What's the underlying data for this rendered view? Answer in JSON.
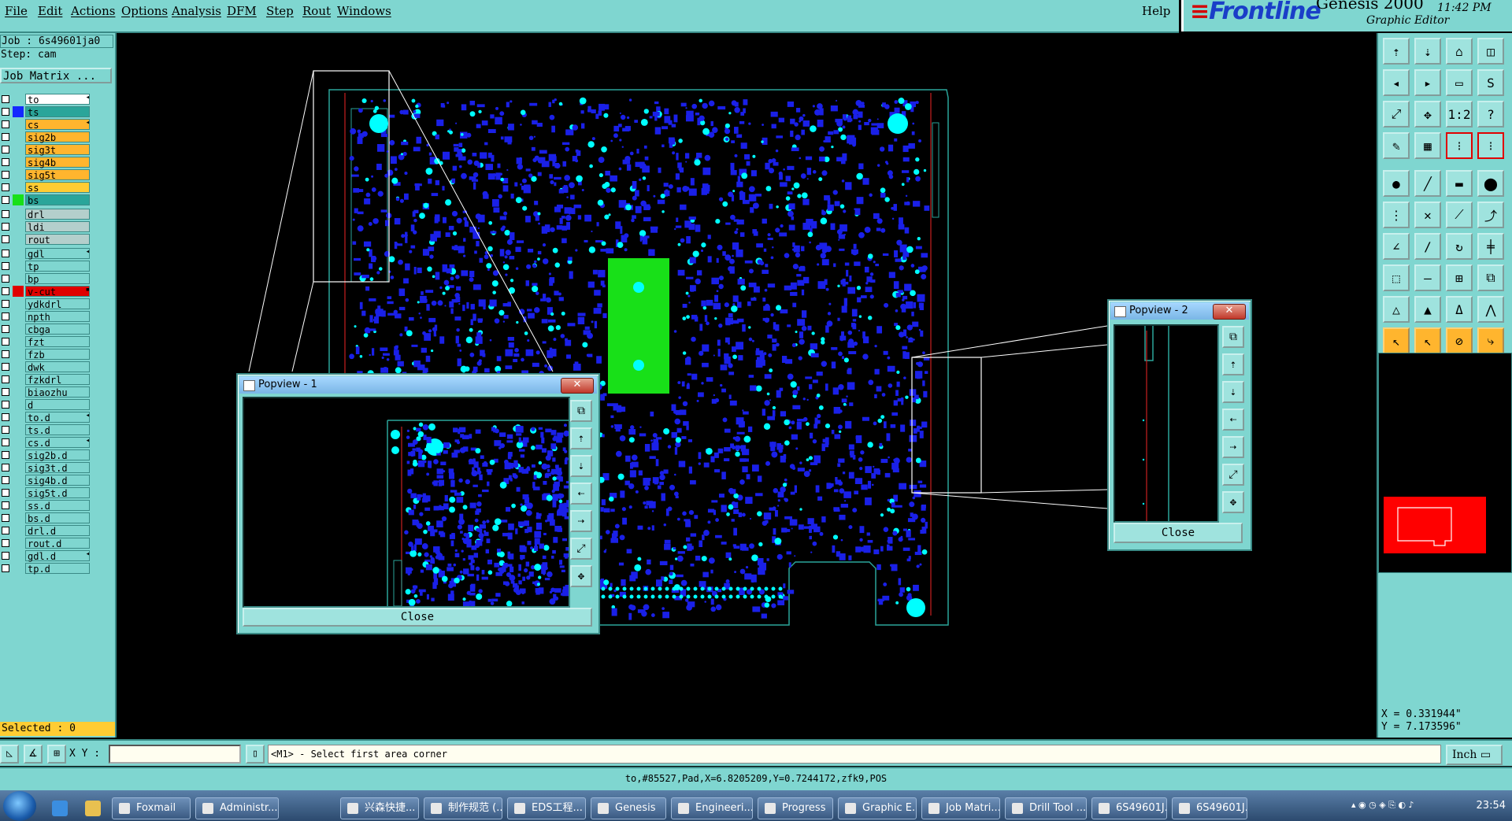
{
  "menu": {
    "items": [
      "File",
      "Edit",
      "Actions",
      "Options",
      "Analysis",
      "DFM",
      "Step",
      "Rout",
      "Windows"
    ],
    "help": "Help"
  },
  "brand": {
    "logo_prefix": "≡",
    "logo": "Frontline",
    "product": "Genesis 2000",
    "subtitle": "Graphic Editor",
    "clock": "11:42 PM"
  },
  "left_panel": {
    "job": "Job : 6s49601ja0",
    "step": "Step: cam",
    "job_matrix": "Job Matrix ...",
    "selected": "Selected : 0"
  },
  "layers": [
    {
      "name": "to",
      "color": "#ffffff",
      "swatch": "",
      "mark": "◂",
      "group": 1
    },
    {
      "name": "ts",
      "color": "#2aa59a",
      "swatch": "#1428ff",
      "mark": "",
      "group": 1
    },
    {
      "name": "cs",
      "color": "#ffb52e",
      "swatch": "",
      "mark": "◂",
      "group": 1
    },
    {
      "name": "sig2b",
      "color": "#ffb52e",
      "swatch": "",
      "mark": "",
      "group": 1
    },
    {
      "name": "sig3t",
      "color": "#ffb52e",
      "swatch": "",
      "mark": "",
      "group": 1
    },
    {
      "name": "sig4b",
      "color": "#ffb52e",
      "swatch": "",
      "mark": "",
      "group": 1
    },
    {
      "name": "sig5t",
      "color": "#ffb52e",
      "swatch": "",
      "mark": "",
      "group": 1
    },
    {
      "name": "ss",
      "color": "#ffcc33",
      "swatch": "",
      "mark": "",
      "group": 1
    },
    {
      "name": "bs",
      "color": "#2aa59a",
      "swatch": "#18e018",
      "mark": "",
      "group": 1
    },
    {
      "name": "drl",
      "color": "#b4cfcc",
      "swatch": "",
      "mark": "",
      "group": 2
    },
    {
      "name": "ldi",
      "color": "#b4cfcc",
      "swatch": "",
      "mark": "",
      "group": 2
    },
    {
      "name": "rout",
      "color": "#b4cfcc",
      "swatch": "",
      "mark": "",
      "group": 2
    },
    {
      "name": "gdl",
      "color": "#7fd6d0",
      "swatch": "",
      "mark": "◂",
      "group": 3
    },
    {
      "name": "tp",
      "color": "#7fd6d0",
      "swatch": "",
      "mark": "",
      "group": 3
    },
    {
      "name": "bp",
      "color": "#7fd6d0",
      "swatch": "",
      "mark": "",
      "group": 3
    },
    {
      "name": "v-cut",
      "color": "#e00000",
      "swatch": "#e00000",
      "mark": "▪",
      "group": 3
    },
    {
      "name": "ydkdrl",
      "color": "#7fd6d0",
      "swatch": "",
      "mark": "",
      "group": 3
    },
    {
      "name": "npth",
      "color": "#7fd6d0",
      "swatch": "",
      "mark": "",
      "group": 3
    },
    {
      "name": "cbga",
      "color": "#7fd6d0",
      "swatch": "",
      "mark": "",
      "group": 3
    },
    {
      "name": "fzt",
      "color": "#7fd6d0",
      "swatch": "",
      "mark": "",
      "group": 3
    },
    {
      "name": "fzb",
      "color": "#7fd6d0",
      "swatch": "",
      "mark": "",
      "group": 3
    },
    {
      "name": "dwk",
      "color": "#7fd6d0",
      "swatch": "",
      "mark": "",
      "group": 3
    },
    {
      "name": "fzkdrl",
      "color": "#7fd6d0",
      "swatch": "",
      "mark": "",
      "group": 3
    },
    {
      "name": "biaozhu",
      "color": "#7fd6d0",
      "swatch": "",
      "mark": "",
      "group": 3
    },
    {
      "name": "d",
      "color": "#7fd6d0",
      "swatch": "",
      "mark": "",
      "group": 3
    },
    {
      "name": "to.d",
      "color": "#7fd6d0",
      "swatch": "",
      "mark": "◂",
      "group": 3
    },
    {
      "name": "ts.d",
      "color": "#7fd6d0",
      "swatch": "",
      "mark": "",
      "group": 3
    },
    {
      "name": "cs.d",
      "color": "#7fd6d0",
      "swatch": "",
      "mark": "◂",
      "group": 3
    },
    {
      "name": "sig2b.d",
      "color": "#7fd6d0",
      "swatch": "",
      "mark": "",
      "group": 3
    },
    {
      "name": "sig3t.d",
      "color": "#7fd6d0",
      "swatch": "",
      "mark": "",
      "group": 3
    },
    {
      "name": "sig4b.d",
      "color": "#7fd6d0",
      "swatch": "",
      "mark": "",
      "group": 3
    },
    {
      "name": "sig5t.d",
      "color": "#7fd6d0",
      "swatch": "",
      "mark": "",
      "group": 3
    },
    {
      "name": "ss.d",
      "color": "#7fd6d0",
      "swatch": "",
      "mark": "",
      "group": 3
    },
    {
      "name": "bs.d",
      "color": "#7fd6d0",
      "swatch": "",
      "mark": "",
      "group": 3
    },
    {
      "name": "drl.d",
      "color": "#7fd6d0",
      "swatch": "",
      "mark": "",
      "group": 3
    },
    {
      "name": "rout.d",
      "color": "#7fd6d0",
      "swatch": "",
      "mark": "",
      "group": 3
    },
    {
      "name": "gdl.d",
      "color": "#7fd6d0",
      "swatch": "",
      "mark": "◂",
      "group": 3
    },
    {
      "name": "tp.d",
      "color": "#7fd6d0",
      "swatch": "",
      "mark": "",
      "group": 3
    }
  ],
  "toolbar": {
    "buttons": [
      {
        "icon": "insert-icon",
        "glyph": "⇡",
        "style": ""
      },
      {
        "icon": "download-icon",
        "glyph": "⇣",
        "style": ""
      },
      {
        "icon": "home-icon",
        "glyph": "⌂",
        "style": ""
      },
      {
        "icon": "split-icon",
        "glyph": "◫",
        "style": ""
      },
      {
        "icon": "pan-left-icon",
        "glyph": "◂",
        "style": ""
      },
      {
        "icon": "pan-right-icon",
        "glyph": "▸",
        "style": ""
      },
      {
        "icon": "window-icon",
        "glyph": "▭",
        "style": ""
      },
      {
        "icon": "s-icon",
        "glyph": "S",
        "style": ""
      },
      {
        "icon": "zoom-fit-icon",
        "glyph": "⤢",
        "style": ""
      },
      {
        "icon": "zoom-center-icon",
        "glyph": "✥",
        "style": ""
      },
      {
        "icon": "one-to-two-icon",
        "glyph": "1:2",
        "style": ""
      },
      {
        "icon": "help-icon",
        "glyph": "?",
        "style": ""
      },
      {
        "icon": "brush-icon",
        "glyph": "✎",
        "style": ""
      },
      {
        "icon": "grid-icon",
        "glyph": "▦",
        "style": ""
      },
      {
        "icon": "layer-link-icon",
        "glyph": "⁝",
        "style": "red"
      },
      {
        "icon": "layer-unlink-icon",
        "glyph": "⁝",
        "style": "red"
      },
      {
        "icon": "pad-icon",
        "glyph": "●",
        "style": ""
      },
      {
        "icon": "line-icon",
        "glyph": "╱",
        "style": ""
      },
      {
        "icon": "ruler-icon",
        "glyph": "▬",
        "style": ""
      },
      {
        "icon": "dot-icon",
        "glyph": "⬤",
        "style": ""
      },
      {
        "icon": "connect-icon",
        "glyph": "⋮",
        "style": ""
      },
      {
        "icon": "cross-icon",
        "glyph": "✕",
        "style": ""
      },
      {
        "icon": "diagonal-icon",
        "glyph": "⟋",
        "style": ""
      },
      {
        "icon": "arc-icon",
        "glyph": "⤴",
        "style": ""
      },
      {
        "icon": "angle-icon",
        "glyph": "∠",
        "style": ""
      },
      {
        "icon": "slash-icon",
        "glyph": "∕",
        "style": ""
      },
      {
        "icon": "rotate-icon",
        "glyph": "↻",
        "style": ""
      },
      {
        "icon": "fence-icon",
        "glyph": "╪",
        "style": ""
      },
      {
        "icon": "move-icon",
        "glyph": "⬚",
        "style": ""
      },
      {
        "icon": "dash-icon",
        "glyph": "—",
        "style": ""
      },
      {
        "icon": "measure-icon",
        "glyph": "⊞",
        "style": ""
      },
      {
        "icon": "copy-icon",
        "glyph": "⧉",
        "style": ""
      },
      {
        "icon": "triangle-icon",
        "glyph": "△",
        "style": ""
      },
      {
        "icon": "triangle-a-icon",
        "glyph": "▲",
        "style": ""
      },
      {
        "icon": "delta-icon",
        "glyph": "Δ",
        "style": ""
      },
      {
        "icon": "peak-icon",
        "glyph": "⋀",
        "style": ""
      },
      {
        "icon": "pointer-icon",
        "glyph": "↖",
        "style": "org"
      },
      {
        "icon": "pointer-select-icon",
        "glyph": "↖",
        "style": "org"
      },
      {
        "icon": "lasso-icon",
        "glyph": "⊘",
        "style": "org"
      },
      {
        "icon": "route-icon",
        "glyph": "⤷",
        "style": "org"
      }
    ]
  },
  "coords": {
    "x": "X = 0.331944\"",
    "y": "Y = 7.173596\""
  },
  "command": {
    "xy_label": "X Y :",
    "prompt": "<M1> - Select first area corner",
    "unit": "Inch"
  },
  "status": "to,#85527,Pad,X=6.8205209,Y=0.7244172,zfk9,POS",
  "popview1": {
    "title": "Popview - 1",
    "close": "Close",
    "tools": [
      "zoom-in-icon",
      "top-icon",
      "bottom-icon",
      "left-icon",
      "right-icon",
      "fit-icon",
      "center-icon"
    ]
  },
  "popview2": {
    "title": "Popview - 2",
    "close": "Close",
    "tools": [
      "zoom-in-icon",
      "top-icon",
      "bottom-icon",
      "left-icon",
      "right-icon",
      "fit-icon",
      "center-icon"
    ]
  },
  "taskbar": {
    "tasks": [
      "Foxmail",
      "Administr...",
      "兴森快捷...",
      "制作规范 (...",
      "EDS工程...",
      "Genesis",
      "Engineeri...",
      "Progress",
      "Graphic E...",
      "Job Matri...",
      "Drill Tool ...",
      "6S49601J...",
      "6S49601J..."
    ],
    "time": "23:54"
  }
}
